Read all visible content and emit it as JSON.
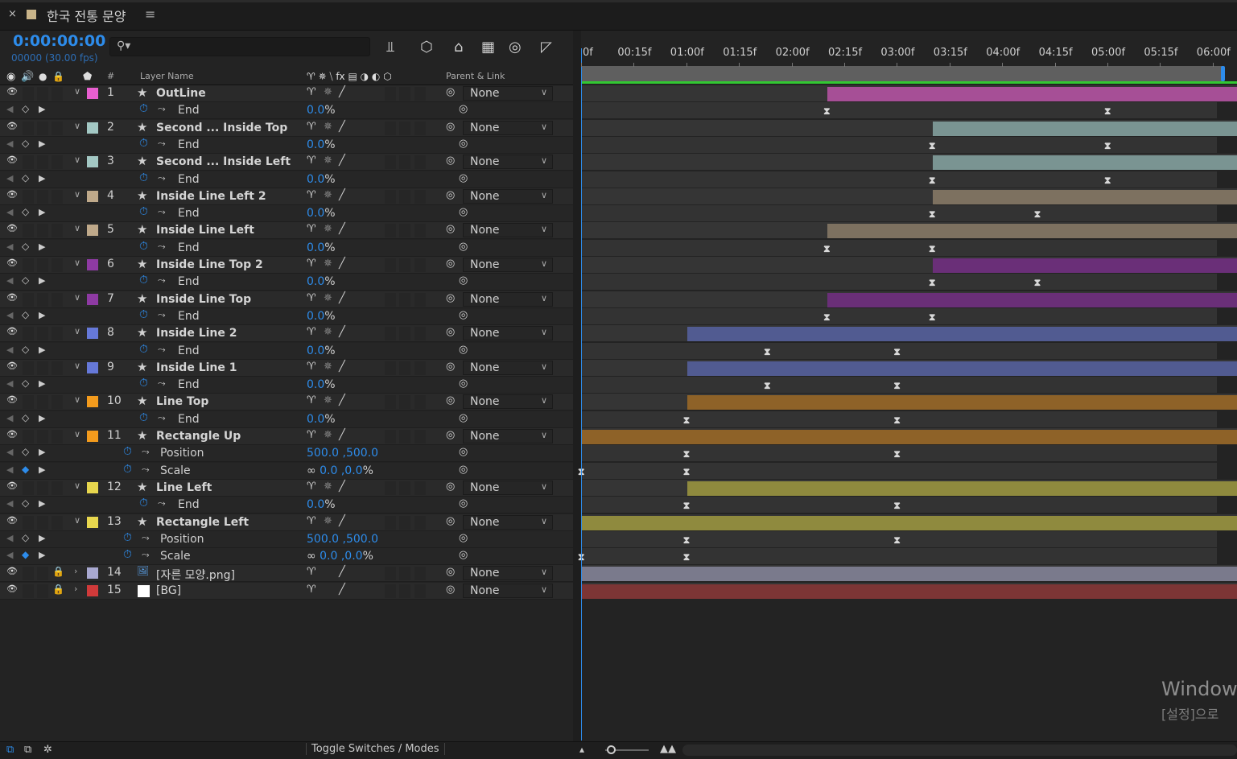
{
  "window": {
    "close_glyph": "×",
    "title": "한국 전통 문양",
    "menu_glyph": "≡"
  },
  "header": {
    "timecode": "0:00:00:00",
    "frames": "00000 (30.00 fps)",
    "search_icon": "search-icon",
    "tools": [
      "composition-flowchart-icon",
      "draft-3d-icon",
      "shy-icon",
      "frame-blending-icon",
      "motion-blur-icon",
      "graph-editor-icon"
    ]
  },
  "ruler": {
    "ticks": [
      "0f",
      "00:15f",
      "01:00f",
      "01:15f",
      "02:00f",
      "02:15f",
      "03:00f",
      "03:15f",
      "04:00f",
      "04:15f",
      "05:00f",
      "05:15f",
      "06:00f"
    ]
  },
  "columns": {
    "num": "#",
    "layer_name": "Layer Name",
    "parent": "Parent & Link"
  },
  "layers": [
    {
      "num": "1",
      "name": "OutLine",
      "color": "#e85fd0",
      "parent": "None",
      "bar_start": 2.333,
      "bar_color": "#a64f96",
      "props": [
        {
          "name": "End",
          "value": "0.0",
          "unit": "%",
          "keys": [
            2.333,
            5.0
          ]
        }
      ]
    },
    {
      "num": "2",
      "name": "Second ... Inside Top",
      "color": "#a3c8c4",
      "parent": "None",
      "bar_start": 3.333,
      "bar_color": "#7a9492",
      "props": [
        {
          "name": "End",
          "value": "0.0",
          "unit": "%",
          "keys": [
            3.333,
            5.0
          ]
        }
      ]
    },
    {
      "num": "3",
      "name": "Second ... Inside Left",
      "color": "#a3c8c4",
      "parent": "None",
      "bar_start": 3.333,
      "bar_color": "#7a9492",
      "props": [
        {
          "name": "End",
          "value": "0.0",
          "unit": "%",
          "keys": [
            3.333,
            5.0
          ]
        }
      ]
    },
    {
      "num": "4",
      "name": "Inside Line Left 2",
      "color": "#bfa98a",
      "parent": "None",
      "bar_start": 3.333,
      "bar_color": "#7d7160",
      "props": [
        {
          "name": "End",
          "value": "0.0",
          "unit": "%",
          "keys": [
            3.333,
            4.333
          ]
        }
      ]
    },
    {
      "num": "5",
      "name": "Inside Line Left",
      "color": "#bfa98a",
      "parent": "None",
      "bar_start": 2.333,
      "bar_color": "#7d7160",
      "props": [
        {
          "name": "End",
          "value": "0.0",
          "unit": "%",
          "keys": [
            2.333,
            3.333
          ]
        }
      ]
    },
    {
      "num": "6",
      "name": "Inside Line Top 2",
      "color": "#8e3aa3",
      "parent": "None",
      "bar_start": 3.333,
      "bar_color": "#6a2f78",
      "props": [
        {
          "name": "End",
          "value": "0.0",
          "unit": "%",
          "keys": [
            3.333,
            4.333
          ]
        }
      ]
    },
    {
      "num": "7",
      "name": "Inside Line Top",
      "color": "#8e3aa3",
      "parent": "None",
      "bar_start": 2.333,
      "bar_color": "#6a2f78",
      "props": [
        {
          "name": "End",
          "value": "0.0",
          "unit": "%",
          "keys": [
            2.333,
            3.333
          ]
        }
      ]
    },
    {
      "num": "8",
      "name": "Inside Line 2",
      "color": "#6679d9",
      "parent": "None",
      "bar_start": 1.0,
      "bar_color": "#515b91",
      "props": [
        {
          "name": "End",
          "value": "0.0",
          "unit": "%",
          "keys": [
            1.767,
            3.0
          ]
        }
      ]
    },
    {
      "num": "9",
      "name": "Inside Line 1",
      "color": "#6679d9",
      "parent": "None",
      "bar_start": 1.0,
      "bar_color": "#515b91",
      "props": [
        {
          "name": "End",
          "value": "0.0",
          "unit": "%",
          "keys": [
            1.767,
            3.0
          ]
        }
      ]
    },
    {
      "num": "10",
      "name": "Line Top",
      "color": "#f39b1d",
      "parent": "None",
      "bar_start": 1.0,
      "bar_color": "#8e6228",
      "props": [
        {
          "name": "End",
          "value": "0.0",
          "unit": "%",
          "keys": [
            1.0,
            3.0
          ]
        }
      ]
    },
    {
      "num": "11",
      "name": "Rectangle Up",
      "color": "#f39b1d",
      "parent": "None",
      "bar_start": 0.0,
      "bar_color": "#8e6228",
      "props": [
        {
          "name": "Position",
          "value": "500.0 ,500.0",
          "unit": "",
          "keys": [
            1.0,
            3.0
          ],
          "indent": true
        },
        {
          "name": "Scale",
          "value": "0.0 ,0.0",
          "unit": "%",
          "keys": [
            0.0,
            1.0
          ],
          "indent": true,
          "link": true,
          "keyed": true
        }
      ]
    },
    {
      "num": "12",
      "name": "Line Left",
      "color": "#e8d74e",
      "parent": "None",
      "bar_start": 1.0,
      "bar_color": "#8f8a3e",
      "props": [
        {
          "name": "End",
          "value": "0.0",
          "unit": "%",
          "keys": [
            1.0,
            3.0
          ]
        }
      ]
    },
    {
      "num": "13",
      "name": "Rectangle Left",
      "color": "#e8d74e",
      "parent": "None",
      "bar_start": 0.0,
      "bar_color": "#8f8a3e",
      "props": [
        {
          "name": "Position",
          "value": "500.0 ,500.0",
          "unit": "",
          "keys": [
            1.0,
            3.0
          ],
          "indent": true
        },
        {
          "name": "Scale",
          "value": "0.0 ,0.0",
          "unit": "%",
          "keys": [
            0.0,
            1.0
          ],
          "indent": true,
          "link": true,
          "keyed": true
        }
      ]
    },
    {
      "num": "14",
      "name": "[자른 모양.png]",
      "color": "#a8a8d0",
      "parent": "None",
      "bar_start": 0.0,
      "bar_color": "#7a7a8c",
      "locked": true,
      "footage": true,
      "props": []
    },
    {
      "num": "15",
      "name": "[BG]",
      "color": "#d03a3a",
      "parent": "None",
      "bar_start": 0.0,
      "bar_color": "#7c3535",
      "locked": true,
      "solid": true,
      "props": []
    }
  ],
  "bottom": {
    "toggle": "Toggle Switches / Modes"
  },
  "watermark": {
    "line1": "Window",
    "line2": "[설정]으로 "
  }
}
